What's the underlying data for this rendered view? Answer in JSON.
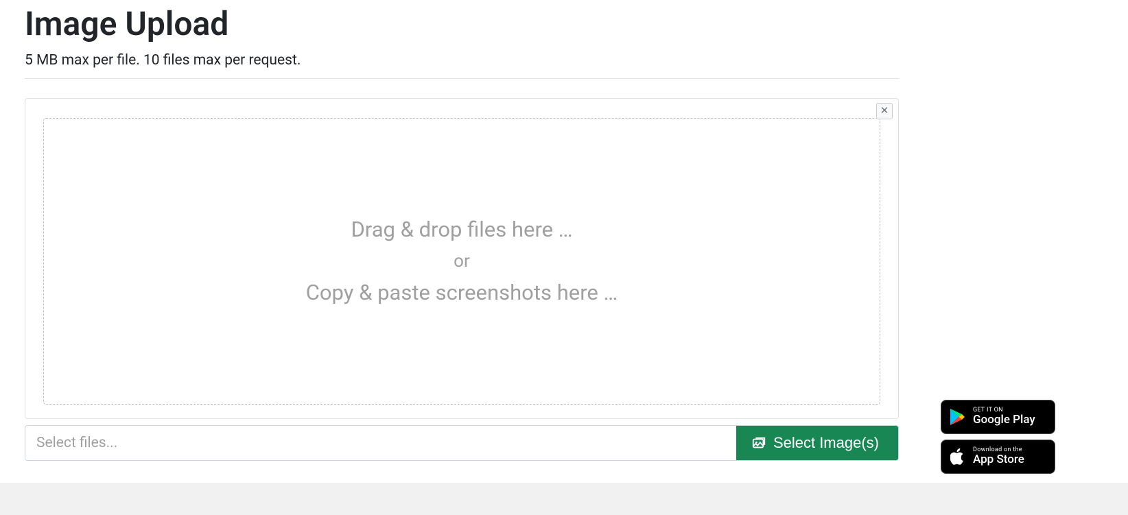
{
  "header": {
    "title": "Image Upload",
    "subtitle": "5 MB max per file. 10 files max per request."
  },
  "dropzone": {
    "line1": "Drag & drop files here …",
    "or": "or",
    "line2": "Copy & paste screenshots here …"
  },
  "fileRow": {
    "placeholder": "Select files...",
    "buttonLabel": "Select Image(s)"
  },
  "badges": {
    "google": {
      "top": "GET IT ON",
      "bottom": "Google Play"
    },
    "apple": {
      "top": "Download on the",
      "bottom": "App Store"
    }
  }
}
